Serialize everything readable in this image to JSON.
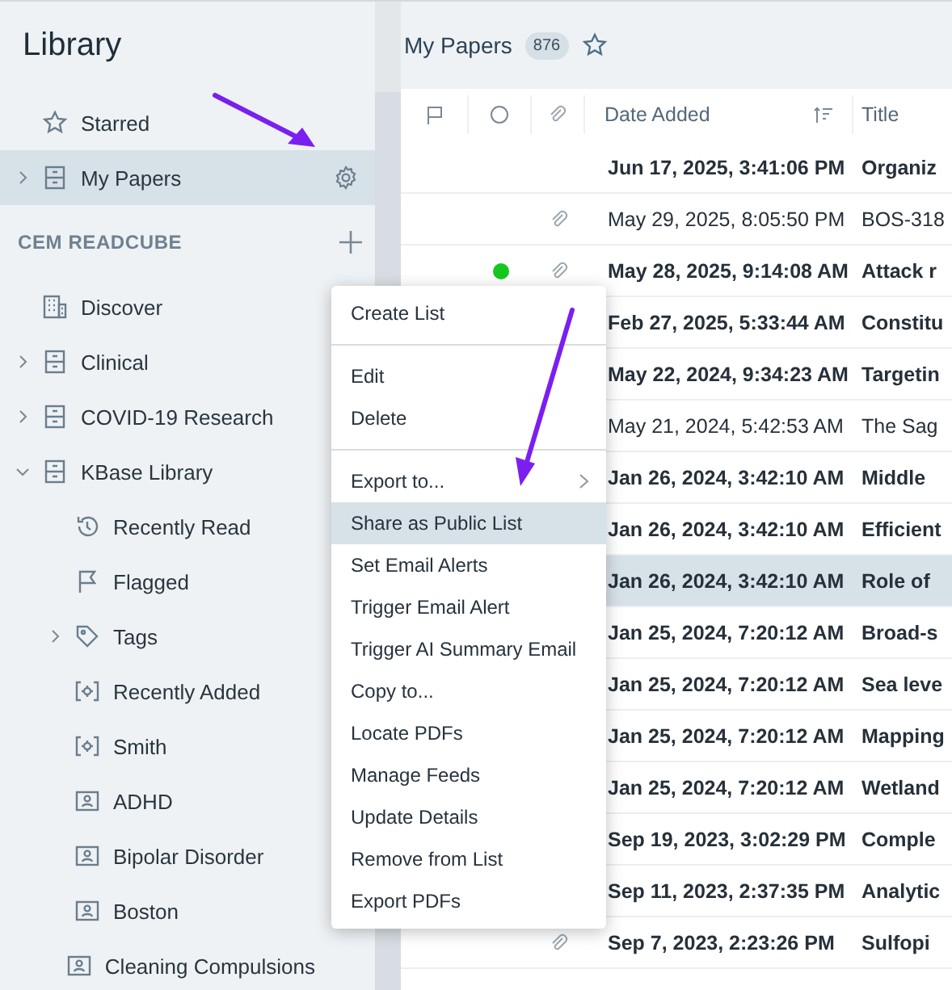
{
  "sidebar": {
    "title": "Library",
    "top_items": [
      {
        "label": "Starred",
        "kind": "star",
        "selected": false
      },
      {
        "label": "My Papers",
        "kind": "list",
        "selected": true,
        "expanded": false,
        "settings": true
      }
    ],
    "section": {
      "title": "CEM READCUBE",
      "items": [
        {
          "label": "Discover",
          "kind": "discover",
          "selected": false
        },
        {
          "label": "Clinical",
          "kind": "list",
          "selected": false,
          "expanded": false
        },
        {
          "label": "COVID-19 Research",
          "kind": "list",
          "selected": false,
          "expanded": false
        },
        {
          "label": "KBase Library",
          "kind": "list",
          "selected": false,
          "expanded": true,
          "children": [
            {
              "label": "Recently Read",
              "kind": "history",
              "selected": false
            },
            {
              "label": "Flagged",
              "kind": "flag",
              "selected": false
            },
            {
              "label": "Tags",
              "kind": "tag",
              "selected": false,
              "expanded": false
            },
            {
              "label": "Recently Added",
              "kind": "smart",
              "selected": false
            },
            {
              "label": "Smith",
              "kind": "smart",
              "selected": false
            },
            {
              "label": "ADHD",
              "kind": "shared",
              "selected": false
            },
            {
              "label": "Bipolar Disorder",
              "kind": "shared",
              "selected": false
            },
            {
              "label": "Boston",
              "kind": "shared",
              "selected": false
            },
            {
              "label": "Cleaning Compulsions",
              "kind": "shared",
              "selected": false
            }
          ]
        }
      ]
    }
  },
  "main": {
    "title": "My Papers",
    "count": "876",
    "starred": false,
    "table": {
      "columns": [
        "Date Added",
        "Title"
      ],
      "rows": [
        {
          "date": "Jun 17, 2025, 3:41:06 PM",
          "title": "Organiz",
          "unread": true,
          "attachment": false,
          "dot": false,
          "selected": false
        },
        {
          "date": "May 29, 2025, 8:05:50 PM",
          "title": "BOS-318",
          "unread": false,
          "attachment": true,
          "dot": false,
          "selected": false
        },
        {
          "date": "May 28, 2025, 9:14:08 AM",
          "title": "Attack r",
          "unread": true,
          "attachment": true,
          "dot": true,
          "selected": false
        },
        {
          "date": "Feb 27, 2025, 5:33:44 AM",
          "title": "Constitu",
          "unread": true,
          "selected": false
        },
        {
          "date": "May 22, 2024, 9:34:23 AM",
          "title": "Targetin",
          "unread": true,
          "selected": false
        },
        {
          "date": "May 21, 2024, 5:42:53 AM",
          "title": "The Sag",
          "unread": false,
          "selected": false
        },
        {
          "date": "Jan 26, 2024, 3:42:10 AM",
          "title": "Middle",
          "unread": true,
          "selected": false
        },
        {
          "date": "Jan 26, 2024, 3:42:10 AM",
          "title": "Efficient",
          "unread": true,
          "selected": false
        },
        {
          "date": "Jan 26, 2024, 3:42:10 AM",
          "title": "Role of",
          "unread": true,
          "selected": true
        },
        {
          "date": "Jan 25, 2024, 7:20:12 AM",
          "title": "Broad-s",
          "unread": true,
          "selected": false
        },
        {
          "date": "Jan 25, 2024, 7:20:12 AM",
          "title": "Sea leve",
          "unread": true,
          "selected": false
        },
        {
          "date": "Jan 25, 2024, 7:20:12 AM",
          "title": "Mapping",
          "unread": true,
          "selected": false
        },
        {
          "date": "Jan 25, 2024, 7:20:12 AM",
          "title": "Wetland",
          "unread": true,
          "selected": false
        },
        {
          "date": "Sep 19, 2023, 3:02:29 PM",
          "title": "Comple",
          "unread": true,
          "selected": false
        },
        {
          "date": "Sep 11, 2023, 2:37:35 PM",
          "title": "Analytic",
          "unread": true,
          "selected": false
        },
        {
          "date": "Sep 7, 2023, 2:23:26 PM",
          "title": "Sulfopi",
          "unread": true,
          "attachment": true,
          "dot": false,
          "selected": false
        }
      ]
    }
  },
  "context_menu": {
    "groups": [
      [
        {
          "label": "Create List",
          "selected": false
        }
      ],
      [
        {
          "label": "Edit",
          "selected": false
        },
        {
          "label": "Delete",
          "selected": false
        }
      ],
      [
        {
          "label": "Export to...",
          "selected": false,
          "submenu": true
        },
        {
          "label": "Share as Public List",
          "selected": true
        },
        {
          "label": "Set Email Alerts",
          "selected": false
        },
        {
          "label": "Trigger Email Alert",
          "selected": false
        },
        {
          "label": "Trigger AI Summary Email",
          "selected": false
        },
        {
          "label": "Copy to...",
          "selected": false
        },
        {
          "label": "Locate PDFs",
          "selected": false
        },
        {
          "label": "Manage Feeds",
          "selected": false
        },
        {
          "label": "Update Details",
          "selected": false
        },
        {
          "label": "Remove from List",
          "selected": false
        },
        {
          "label": "Export PDFs",
          "selected": false
        }
      ]
    ]
  }
}
